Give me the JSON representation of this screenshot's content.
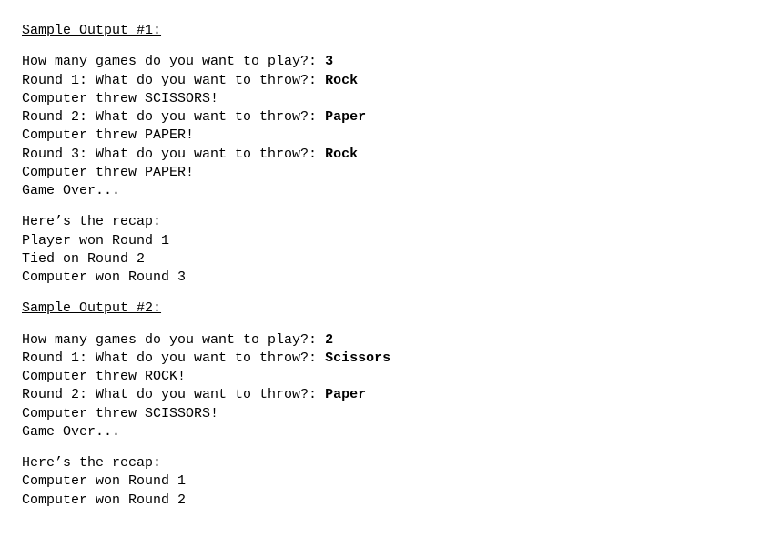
{
  "samples": [
    {
      "heading": "Sample Output #1:",
      "prompt_games": "How many games do you want to play?: ",
      "games_input": "3",
      "rounds": [
        {
          "prompt": "Round 1: What do you want to throw?: ",
          "input": "Rock",
          "result": "Computer threw SCISSORS!"
        },
        {
          "prompt": "Round 2: What do you want to throw?: ",
          "input": "Paper",
          "result": "Computer threw PAPER!"
        },
        {
          "prompt": "Round 3: What do you want to throw?: ",
          "input": "Rock",
          "result": "Computer threw PAPER!"
        }
      ],
      "game_over": "Game Over...",
      "recap_heading": "Here’s the recap:",
      "recap": [
        "Player won Round 1",
        "Tied on Round 2",
        "Computer won Round 3"
      ]
    },
    {
      "heading": "Sample Output #2:",
      "prompt_games": "How many games do you want to play?: ",
      "games_input": "2",
      "rounds": [
        {
          "prompt": "Round 1: What do you want to throw?: ",
          "input": "Scissors",
          "result": "Computer threw ROCK!"
        },
        {
          "prompt": "Round 2: What do you want to throw?: ",
          "input": "Paper",
          "result": "Computer threw SCISSORS!"
        }
      ],
      "game_over": "Game Over...",
      "recap_heading": "Here’s the recap:",
      "recap": [
        "Computer won Round 1",
        "Computer won Round 2"
      ]
    }
  ]
}
